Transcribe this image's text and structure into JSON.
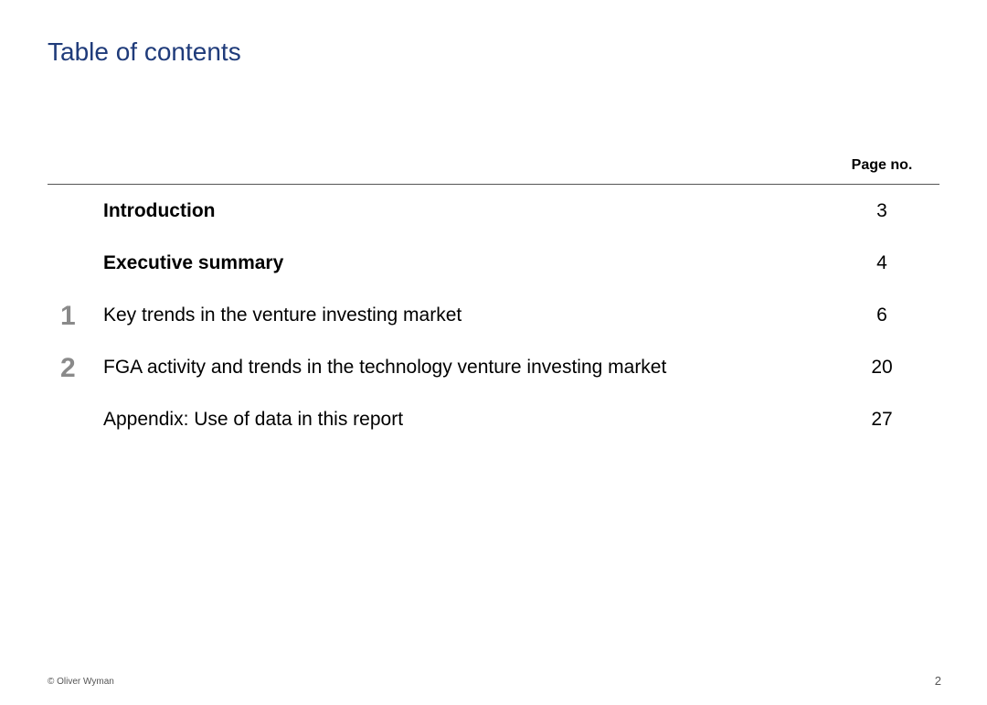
{
  "header": {
    "title": "Table of contents",
    "page_no_label": "Page no."
  },
  "toc": {
    "items": [
      {
        "number": "",
        "label": "Introduction",
        "page": "3"
      },
      {
        "number": "",
        "label": "Executive summary",
        "page": "4"
      },
      {
        "number": "1",
        "label": "Key trends in the venture investing market",
        "page": "6"
      },
      {
        "number": "2",
        "label": "FGA activity and trends in the technology venture investing market",
        "page": "20"
      },
      {
        "number": "",
        "label": "Appendix:  Use of data in this report",
        "page": "27"
      }
    ]
  },
  "footer": {
    "copyright": "© Oliver Wyman",
    "page_number": "2"
  }
}
